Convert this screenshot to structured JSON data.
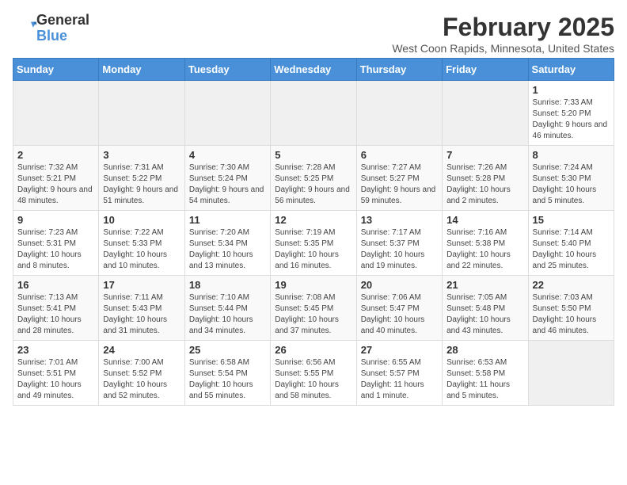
{
  "logo": {
    "general": "General",
    "blue": "Blue"
  },
  "title": "February 2025",
  "subtitle": "West Coon Rapids, Minnesota, United States",
  "days_of_week": [
    "Sunday",
    "Monday",
    "Tuesday",
    "Wednesday",
    "Thursday",
    "Friday",
    "Saturday"
  ],
  "weeks": [
    [
      {
        "day": "",
        "info": ""
      },
      {
        "day": "",
        "info": ""
      },
      {
        "day": "",
        "info": ""
      },
      {
        "day": "",
        "info": ""
      },
      {
        "day": "",
        "info": ""
      },
      {
        "day": "",
        "info": ""
      },
      {
        "day": "1",
        "info": "Sunrise: 7:33 AM\nSunset: 5:20 PM\nDaylight: 9 hours and 46 minutes."
      }
    ],
    [
      {
        "day": "2",
        "info": "Sunrise: 7:32 AM\nSunset: 5:21 PM\nDaylight: 9 hours and 48 minutes."
      },
      {
        "day": "3",
        "info": "Sunrise: 7:31 AM\nSunset: 5:22 PM\nDaylight: 9 hours and 51 minutes."
      },
      {
        "day": "4",
        "info": "Sunrise: 7:30 AM\nSunset: 5:24 PM\nDaylight: 9 hours and 54 minutes."
      },
      {
        "day": "5",
        "info": "Sunrise: 7:28 AM\nSunset: 5:25 PM\nDaylight: 9 hours and 56 minutes."
      },
      {
        "day": "6",
        "info": "Sunrise: 7:27 AM\nSunset: 5:27 PM\nDaylight: 9 hours and 59 minutes."
      },
      {
        "day": "7",
        "info": "Sunrise: 7:26 AM\nSunset: 5:28 PM\nDaylight: 10 hours and 2 minutes."
      },
      {
        "day": "8",
        "info": "Sunrise: 7:24 AM\nSunset: 5:30 PM\nDaylight: 10 hours and 5 minutes."
      }
    ],
    [
      {
        "day": "9",
        "info": "Sunrise: 7:23 AM\nSunset: 5:31 PM\nDaylight: 10 hours and 8 minutes."
      },
      {
        "day": "10",
        "info": "Sunrise: 7:22 AM\nSunset: 5:33 PM\nDaylight: 10 hours and 10 minutes."
      },
      {
        "day": "11",
        "info": "Sunrise: 7:20 AM\nSunset: 5:34 PM\nDaylight: 10 hours and 13 minutes."
      },
      {
        "day": "12",
        "info": "Sunrise: 7:19 AM\nSunset: 5:35 PM\nDaylight: 10 hours and 16 minutes."
      },
      {
        "day": "13",
        "info": "Sunrise: 7:17 AM\nSunset: 5:37 PM\nDaylight: 10 hours and 19 minutes."
      },
      {
        "day": "14",
        "info": "Sunrise: 7:16 AM\nSunset: 5:38 PM\nDaylight: 10 hours and 22 minutes."
      },
      {
        "day": "15",
        "info": "Sunrise: 7:14 AM\nSunset: 5:40 PM\nDaylight: 10 hours and 25 minutes."
      }
    ],
    [
      {
        "day": "16",
        "info": "Sunrise: 7:13 AM\nSunset: 5:41 PM\nDaylight: 10 hours and 28 minutes."
      },
      {
        "day": "17",
        "info": "Sunrise: 7:11 AM\nSunset: 5:43 PM\nDaylight: 10 hours and 31 minutes."
      },
      {
        "day": "18",
        "info": "Sunrise: 7:10 AM\nSunset: 5:44 PM\nDaylight: 10 hours and 34 minutes."
      },
      {
        "day": "19",
        "info": "Sunrise: 7:08 AM\nSunset: 5:45 PM\nDaylight: 10 hours and 37 minutes."
      },
      {
        "day": "20",
        "info": "Sunrise: 7:06 AM\nSunset: 5:47 PM\nDaylight: 10 hours and 40 minutes."
      },
      {
        "day": "21",
        "info": "Sunrise: 7:05 AM\nSunset: 5:48 PM\nDaylight: 10 hours and 43 minutes."
      },
      {
        "day": "22",
        "info": "Sunrise: 7:03 AM\nSunset: 5:50 PM\nDaylight: 10 hours and 46 minutes."
      }
    ],
    [
      {
        "day": "23",
        "info": "Sunrise: 7:01 AM\nSunset: 5:51 PM\nDaylight: 10 hours and 49 minutes."
      },
      {
        "day": "24",
        "info": "Sunrise: 7:00 AM\nSunset: 5:52 PM\nDaylight: 10 hours and 52 minutes."
      },
      {
        "day": "25",
        "info": "Sunrise: 6:58 AM\nSunset: 5:54 PM\nDaylight: 10 hours and 55 minutes."
      },
      {
        "day": "26",
        "info": "Sunrise: 6:56 AM\nSunset: 5:55 PM\nDaylight: 10 hours and 58 minutes."
      },
      {
        "day": "27",
        "info": "Sunrise: 6:55 AM\nSunset: 5:57 PM\nDaylight: 11 hours and 1 minute."
      },
      {
        "day": "28",
        "info": "Sunrise: 6:53 AM\nSunset: 5:58 PM\nDaylight: 11 hours and 5 minutes."
      },
      {
        "day": "",
        "info": ""
      }
    ]
  ]
}
